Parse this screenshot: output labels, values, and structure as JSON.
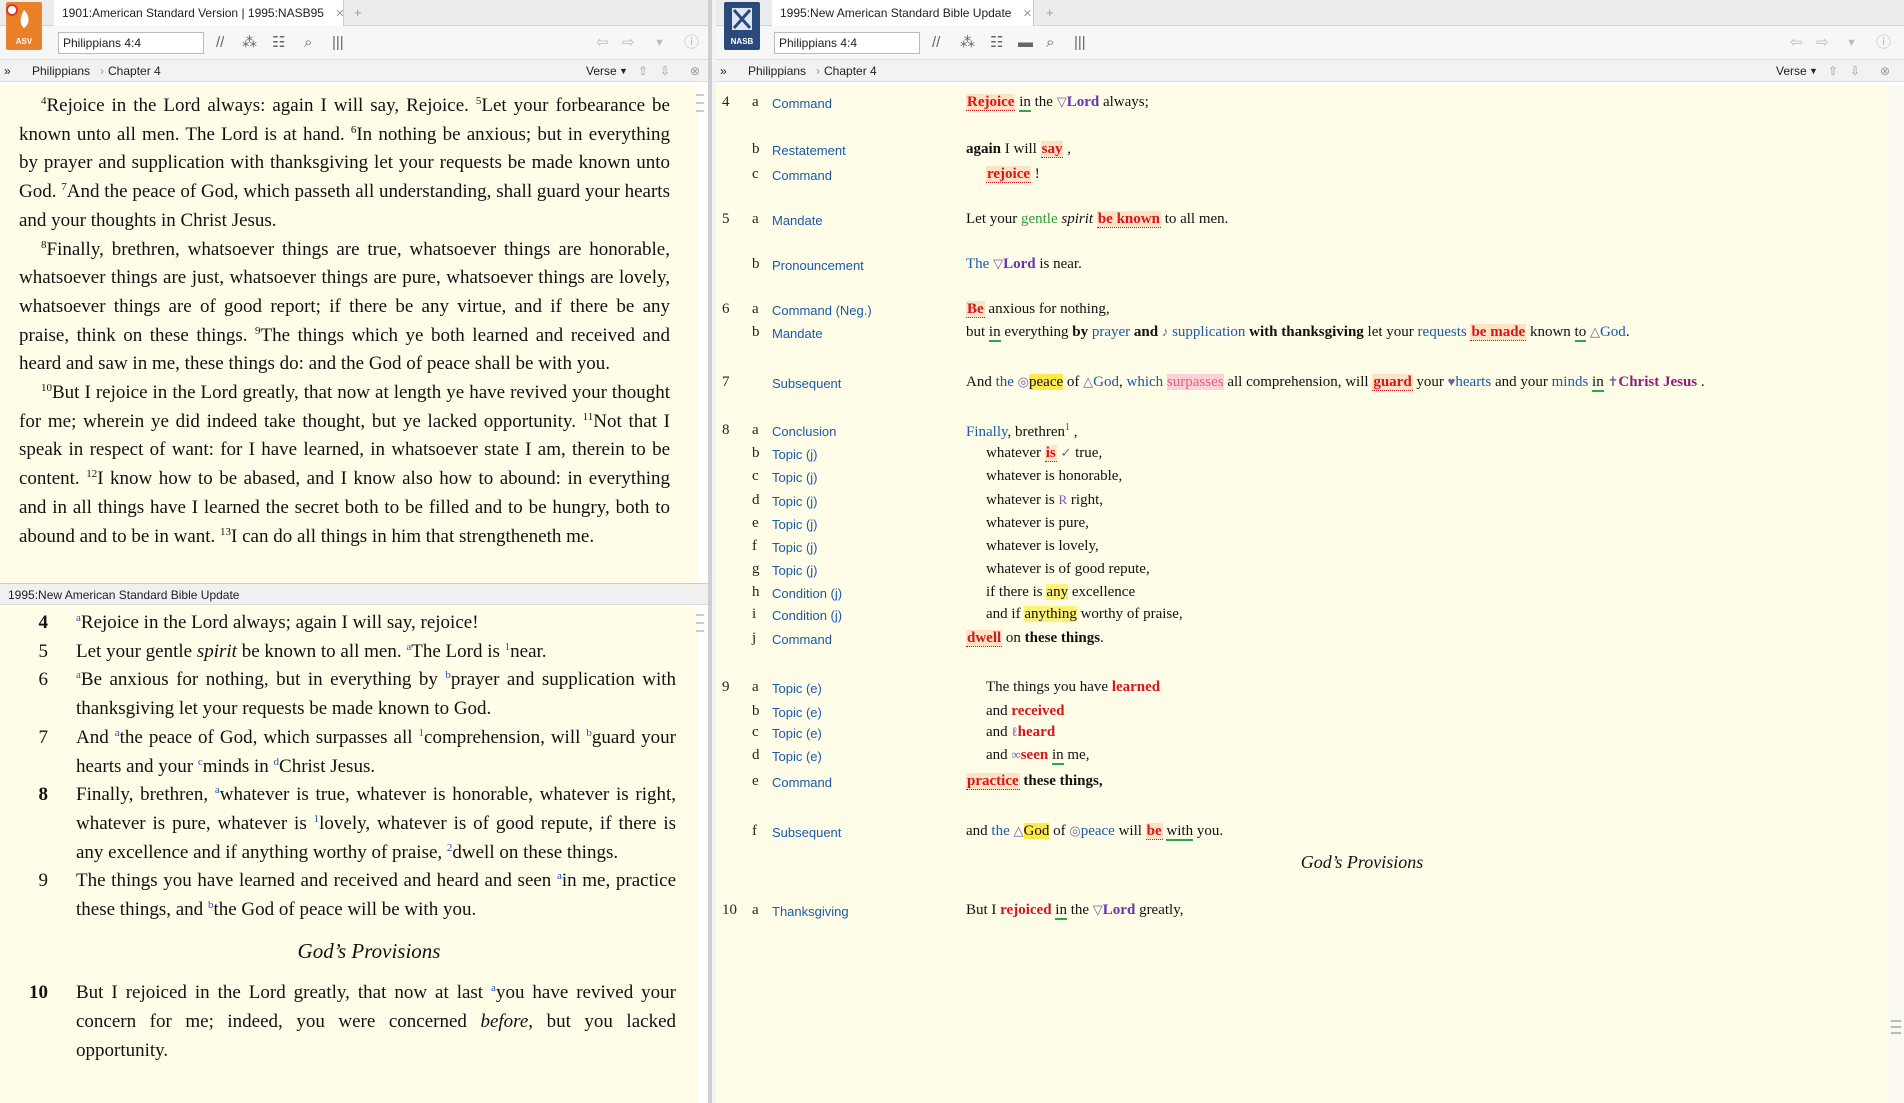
{
  "left": {
    "tab_title": "1901:American Standard Version | 1995:NASB95",
    "app_icon_label": "ASV",
    "reference": "Philippians 4:4",
    "nav_book": "Philippians",
    "nav_chapter": "Chapter 4",
    "nav_mode": "Verse",
    "top_paragraphs": [
      [
        {
          "sup": "4",
          "text": "Rejoice in the Lord always: again I will say, Rejoice. "
        },
        {
          "sup": "5",
          "text": "Let your forbearance be known unto all men. The Lord is at hand. "
        },
        {
          "sup": "6",
          "text": "In nothing be anxious; but in everything by prayer and supplication with thanksgiving let your requests be made known unto God. "
        },
        {
          "sup": "7",
          "text": "And the peace of God, which passeth all understanding, shall guard your hearts and your thoughts in Christ Jesus."
        }
      ],
      [
        {
          "sup": "8",
          "text": "Finally, brethren, whatsoever things are true, whatsoever things are honorable, whatsoever things are just, whatsoever things are pure, whatsoever things are lovely, whatsoever things are of good report; if there be any virtue, and if there be any praise, think on these things. "
        },
        {
          "sup": "9",
          "text": "The things which ye both learned and received and heard and saw in me, these things do: and the God of peace shall be with you."
        }
      ],
      [
        {
          "sup": "10",
          "text": "But I rejoice in the Lord greatly, that now at length ye have revived your thought for me; wherein ye did indeed take thought, but ye lacked opportunity. "
        },
        {
          "sup": "11",
          "text": "Not that I speak in respect of want: for I have learned, in whatsoever state I am, therein to be content. "
        },
        {
          "sup": "12",
          "text": "I know how to be abased, and I know also how to abound: in everything and in all things have I learned the secret both to be filled and to be hungry, both to abound and to be in want. "
        },
        {
          "sup": "13",
          "text": "I can do all things in him that strengtheneth me."
        }
      ]
    ],
    "split_title": "1995:New American Standard Bible Update",
    "verses": [
      {
        "num": "4",
        "bold": true,
        "parts": [
          [
            "fn",
            "a"
          ],
          [
            "t",
            "Rejoice in the Lord always; again I will say, rejoice!"
          ]
        ]
      },
      {
        "num": "5",
        "bold": false,
        "parts": [
          [
            "t",
            "Let your gentle "
          ],
          [
            "i",
            "spirit"
          ],
          [
            "t",
            " be known to all men. "
          ],
          [
            "fn",
            "a"
          ],
          [
            "t",
            "The Lord is "
          ],
          [
            "fn",
            "1"
          ],
          [
            "t",
            "near."
          ]
        ]
      },
      {
        "num": "6",
        "bold": false,
        "parts": [
          [
            "fn",
            "a"
          ],
          [
            "t",
            "Be anxious for nothing, but in everything by "
          ],
          [
            "fn",
            "b"
          ],
          [
            "t",
            "prayer and supplication with thanksgiving let your requests be made known to God."
          ]
        ]
      },
      {
        "num": "7",
        "bold": false,
        "parts": [
          [
            "t",
            "And "
          ],
          [
            "fn",
            "a"
          ],
          [
            "t",
            "the peace of God, which surpasses all "
          ],
          [
            "fn",
            "1"
          ],
          [
            "t",
            "comprehension, will "
          ],
          [
            "fn",
            "b"
          ],
          [
            "t",
            "guard your hearts and your "
          ],
          [
            "fn",
            "c"
          ],
          [
            "t",
            "minds in "
          ],
          [
            "fn",
            "d"
          ],
          [
            "t",
            "Christ Jesus."
          ]
        ]
      },
      {
        "num": "8",
        "bold": true,
        "parts": [
          [
            "t",
            "Finally, brethren, "
          ],
          [
            "fn",
            "a"
          ],
          [
            "t",
            "whatever is true, whatever is honorable, whatever is right, whatever is pure, whatever is "
          ],
          [
            "fn",
            "1"
          ],
          [
            "t",
            "lovely, whatever is of good repute, if there is any excellence and if anything worthy of praise, "
          ],
          [
            "fn",
            "2"
          ],
          [
            "t",
            "dwell on these things."
          ]
        ]
      },
      {
        "num": "9",
        "bold": false,
        "parts": [
          [
            "t",
            "The things you have learned and received and heard and seen "
          ],
          [
            "fn",
            "a"
          ],
          [
            "t",
            "in me, practice these things, and "
          ],
          [
            "fn",
            "b"
          ],
          [
            "t",
            "the God of peace will be with you."
          ]
        ]
      }
    ],
    "section_heading": "God’s Provisions",
    "verses_after": [
      {
        "num": "10",
        "bold": true,
        "parts": [
          [
            "t",
            "But I rejoiced in the Lord greatly, that now at last "
          ],
          [
            "fn",
            "a"
          ],
          [
            "t",
            "you have revived your concern for me; indeed, you were concerned "
          ],
          [
            "i",
            "before"
          ],
          [
            "t",
            ", but you lacked opportunity."
          ]
        ]
      }
    ]
  },
  "right": {
    "tab_title": "1995:New American Standard Bible Update",
    "app_icon_label": "NASB",
    "reference": "Philippians 4:4",
    "nav_book": "Philippians",
    "nav_chapter": "Chapter 4",
    "nav_mode": "Verse",
    "section_heading": "God’s Provisions",
    "rows": [
      {
        "verse": "4",
        "letter": "a",
        "label": "Command",
        "indent": 0,
        "parts": [
          [
            "hl",
            "Rejoice"
          ],
          [
            "t",
            "  "
          ],
          [
            "ul",
            "in"
          ],
          [
            "t",
            " the  "
          ],
          [
            "sym",
            "▽"
          ],
          [
            "lord",
            "Lord"
          ],
          [
            "t",
            " always;"
          ]
        ]
      },
      {
        "verse": "",
        "letter": "b",
        "label": "Restatement",
        "indent": 0,
        "parts": [
          [
            "b",
            "again"
          ],
          [
            "t",
            " I will "
          ],
          [
            "hl",
            "say"
          ],
          [
            "t",
            " ,"
          ]
        ]
      },
      {
        "verse": "",
        "letter": "c",
        "label": "Command",
        "indent": 20,
        "parts": [
          [
            "hl",
            "rejoice"
          ],
          [
            "t",
            "  !"
          ]
        ]
      },
      {
        "verse": "5",
        "letter": "a",
        "label": "Mandate",
        "indent": 0,
        "parts": [
          [
            "t",
            "Let your "
          ],
          [
            "g",
            "gentle"
          ],
          [
            "t",
            " "
          ],
          [
            "i",
            "spirit"
          ],
          [
            "t",
            " "
          ],
          [
            "hl",
            "be known"
          ],
          [
            "t",
            "  to all men."
          ]
        ]
      },
      {
        "verse": "",
        "letter": "b",
        "label": "Pronouncement",
        "indent": 0,
        "parts": [
          [
            "bl",
            "The"
          ],
          [
            "t",
            "  "
          ],
          [
            "sym",
            "▽"
          ],
          [
            "lord",
            "Lord"
          ],
          [
            "t",
            " is near."
          ]
        ]
      },
      {
        "verse": "6",
        "letter": "a",
        "label": "Command (Neg.)",
        "indent": 0,
        "parts": [
          [
            "hl",
            "Be"
          ],
          [
            "t",
            "  anxious for nothing,"
          ]
        ]
      },
      {
        "verse": "",
        "letter": "b",
        "label": "Mandate",
        "indent": 0,
        "parts": [
          [
            "t",
            "but "
          ],
          [
            "ul",
            "in"
          ],
          [
            "t",
            " everything "
          ],
          [
            "b",
            "by "
          ],
          [
            "bl",
            "prayer"
          ],
          [
            "b",
            " and  "
          ],
          [
            "sym",
            "♪"
          ],
          [
            "t",
            " "
          ],
          [
            "bl",
            "supplication"
          ],
          [
            "t",
            " "
          ],
          [
            "b",
            "with thanksgiving"
          ],
          [
            "t",
            " let your "
          ],
          [
            "bl",
            "requests"
          ],
          [
            "t",
            " "
          ],
          [
            "hl",
            "be made"
          ],
          [
            "t",
            "  known "
          ],
          [
            "ul",
            "to"
          ],
          [
            "t",
            "  "
          ],
          [
            "sym",
            "△"
          ],
          [
            "bl",
            "God"
          ],
          [
            "t",
            "."
          ]
        ]
      },
      {
        "verse": "7",
        "letter": "",
        "label": "Subsequent",
        "indent": 0,
        "parts": [
          [
            "t",
            "And "
          ],
          [
            "bl",
            "the"
          ],
          [
            "t",
            "  "
          ],
          [
            "sym",
            "◎"
          ],
          [
            "gd",
            "peace"
          ],
          [
            "t",
            " of  "
          ],
          [
            "sym",
            "△"
          ],
          [
            "bl",
            "God"
          ],
          [
            "t",
            ", "
          ],
          [
            "bl",
            "which"
          ],
          [
            "t",
            " "
          ],
          [
            "pk",
            "surpasses"
          ],
          [
            "t",
            "  all comprehension, will "
          ],
          [
            "hl",
            "guard"
          ],
          [
            "t",
            "  your "
          ],
          [
            "sym",
            "♥"
          ],
          [
            "bl",
            "hearts"
          ],
          [
            "t",
            " and your "
          ],
          [
            "bl",
            "minds"
          ],
          [
            "t",
            " "
          ],
          [
            "ul",
            "in"
          ],
          [
            "t",
            "  "
          ],
          [
            "sym",
            "✝"
          ],
          [
            "cj",
            "Christ Jesus"
          ],
          [
            "t",
            "  ."
          ]
        ]
      },
      {
        "verse": "8",
        "letter": "a",
        "label": "Conclusion",
        "indent": 0,
        "parts": [
          [
            "bl",
            "Finally"
          ],
          [
            "t",
            ", brethren"
          ],
          [
            "fn",
            "1"
          ],
          [
            "t",
            " ,"
          ]
        ]
      },
      {
        "verse": "",
        "letter": "b",
        "label": "Topic (j)",
        "indent": 20,
        "parts": [
          [
            "t",
            "whatever "
          ],
          [
            "hl",
            "is"
          ],
          [
            "t",
            "   "
          ],
          [
            "sym",
            "✓"
          ],
          [
            "t",
            " true,"
          ]
        ]
      },
      {
        "verse": "",
        "letter": "c",
        "label": "Topic (j)",
        "indent": 20,
        "parts": [
          [
            "t",
            "whatever is honorable,"
          ]
        ]
      },
      {
        "verse": "",
        "letter": "d",
        "label": "Topic (j)",
        "indent": 20,
        "parts": [
          [
            "t",
            "whatever is  "
          ],
          [
            "sym",
            "R"
          ],
          [
            "t",
            " right,"
          ]
        ]
      },
      {
        "verse": "",
        "letter": "e",
        "label": "Topic (j)",
        "indent": 20,
        "parts": [
          [
            "t",
            "whatever is pure,"
          ]
        ]
      },
      {
        "verse": "",
        "letter": "f",
        "label": "Topic (j)",
        "indent": 20,
        "parts": [
          [
            "t",
            "whatever is lovely,"
          ]
        ]
      },
      {
        "verse": "",
        "letter": "g",
        "label": "Topic (j)",
        "indent": 20,
        "parts": [
          [
            "t",
            "whatever is of good repute,"
          ]
        ]
      },
      {
        "verse": "",
        "letter": "h",
        "label": "Condition (j)",
        "indent": 20,
        "parts": [
          [
            "t",
            "if there is "
          ],
          [
            "yl",
            "any"
          ],
          [
            "t",
            " excellence"
          ]
        ]
      },
      {
        "verse": "",
        "letter": "i",
        "label": "Condition (j)",
        "indent": 20,
        "parts": [
          [
            "t",
            "and if "
          ],
          [
            "yl",
            "anything"
          ],
          [
            "t",
            " worthy of praise,"
          ]
        ]
      },
      {
        "verse": "",
        "letter": "j",
        "label": "Command",
        "indent": 0,
        "parts": [
          [
            "hl",
            "dwell"
          ],
          [
            "t",
            "  on "
          ],
          [
            "b",
            "these things"
          ],
          [
            "t",
            "."
          ]
        ]
      },
      {
        "verse": "9",
        "letter": "a",
        "label": "Topic (e)",
        "indent": 20,
        "parts": [
          [
            "t",
            "The things you have "
          ],
          [
            "rd",
            "learned"
          ]
        ]
      },
      {
        "verse": "",
        "letter": "b",
        "label": "Topic (e)",
        "indent": 20,
        "parts": [
          [
            "t",
            "and "
          ],
          [
            "rd",
            "received"
          ]
        ]
      },
      {
        "verse": "",
        "letter": "c",
        "label": "Topic (e)",
        "indent": 20,
        "parts": [
          [
            "t",
            "and  "
          ],
          [
            "sym",
            "ℓ"
          ],
          [
            "rd",
            "heard"
          ]
        ]
      },
      {
        "verse": "",
        "letter": "d",
        "label": "Topic (e)",
        "indent": 20,
        "parts": [
          [
            "t",
            "and  "
          ],
          [
            "sym",
            "∞"
          ],
          [
            "rd",
            "seen"
          ],
          [
            "t",
            "  "
          ],
          [
            "ul",
            "in"
          ],
          [
            "t",
            " me,"
          ]
        ]
      },
      {
        "verse": "",
        "letter": "e",
        "label": "Command",
        "indent": 0,
        "parts": [
          [
            "hl",
            "practice"
          ],
          [
            "t",
            "  "
          ],
          [
            "b",
            "these things,"
          ]
        ]
      },
      {
        "verse": "",
        "letter": "f",
        "label": "Subsequent",
        "indent": 0,
        "parts": [
          [
            "t",
            "and "
          ],
          [
            "bl",
            "the"
          ],
          [
            "t",
            "  "
          ],
          [
            "sym",
            "△"
          ],
          [
            "gd",
            "God"
          ],
          [
            "t",
            " of  "
          ],
          [
            "sym",
            "◎"
          ],
          [
            "bl",
            "peace"
          ],
          [
            "t",
            " will "
          ],
          [
            "hl",
            "be"
          ],
          [
            "t",
            "  "
          ],
          [
            "ul",
            "with"
          ],
          [
            "t",
            " you."
          ]
        ]
      },
      {
        "verse": "10",
        "letter": "a",
        "label": "Thanksgiving",
        "indent": 0,
        "parts": [
          [
            "t",
            "But I "
          ],
          [
            "rd",
            "rejoiced"
          ],
          [
            "t",
            "  "
          ],
          [
            "ul",
            "in"
          ],
          [
            "t",
            " the  "
          ],
          [
            "sym",
            "▽"
          ],
          [
            "lord",
            "Lord"
          ],
          [
            "t",
            " greatly,"
          ]
        ]
      }
    ]
  }
}
